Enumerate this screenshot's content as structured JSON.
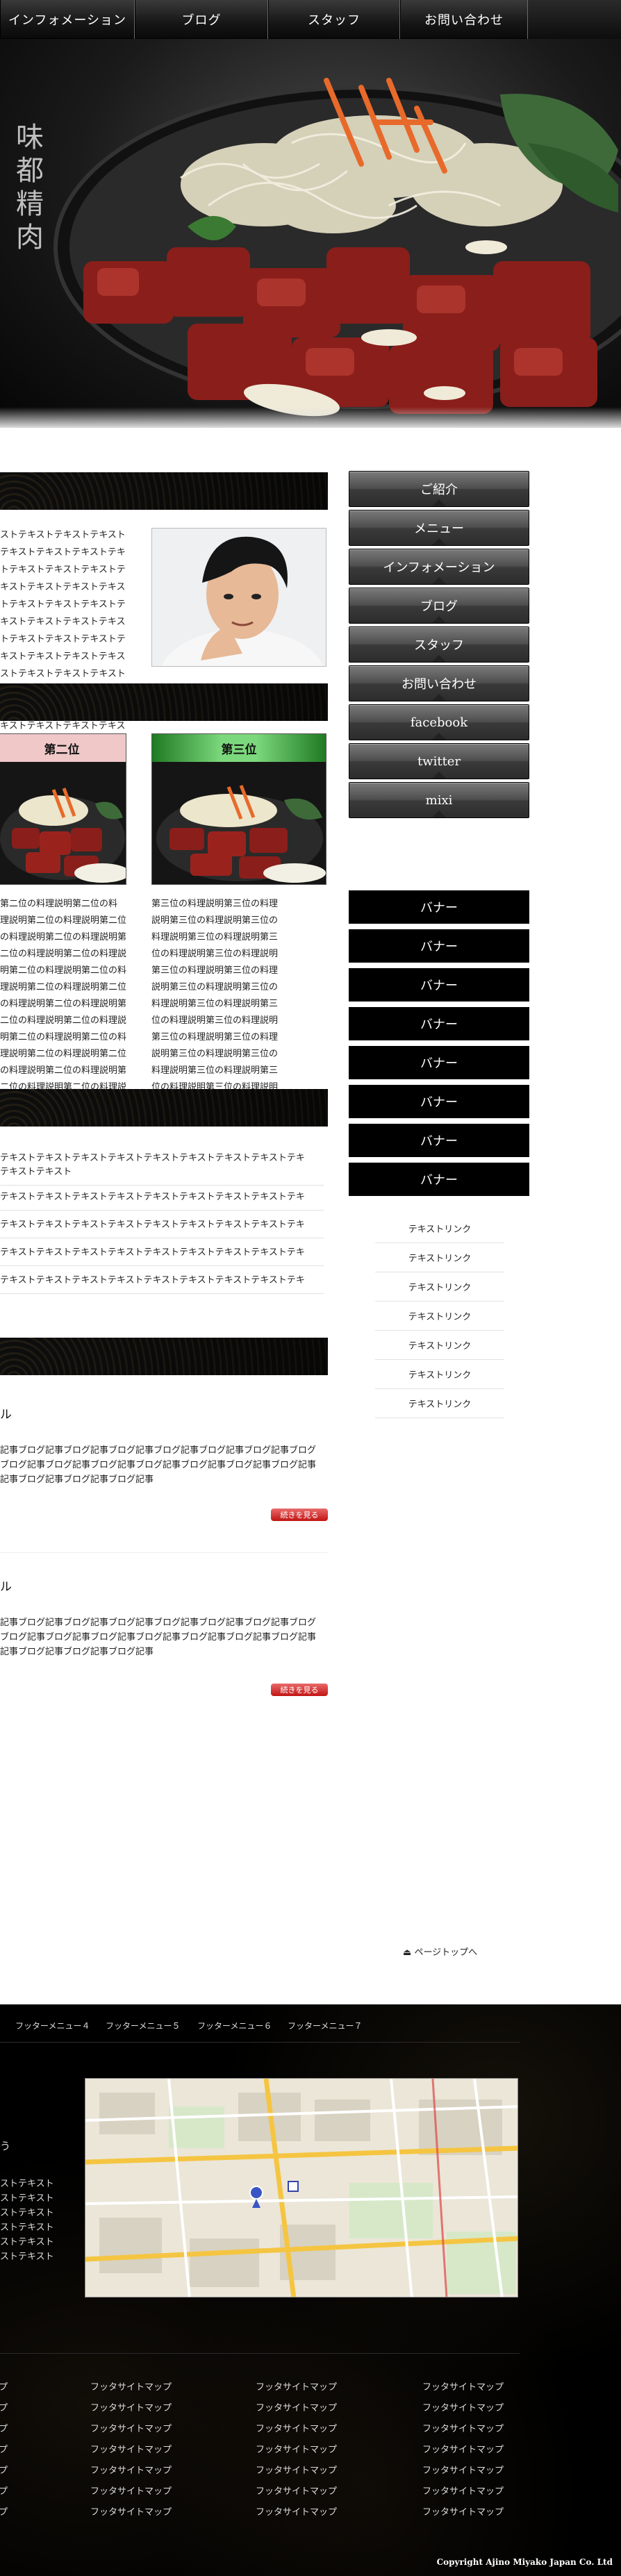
{
  "nav": {
    "items": [
      "インフォメーション",
      "ブログ",
      "スタッフ",
      "お問い合わせ"
    ]
  },
  "hero": {
    "calligraphy": "味都精肉"
  },
  "intro": {
    "text": "ストテキストテキストテキスト\nテキストテキストテキストテキ\nトテキストテキストテキストテ\nキストテキストテキストテキス\nトテキストテキストテキストテ\nキストテキストテキストテキス\nトテキストテキストテキストテ\nキストテキストテキストテキス\nストテキストテキストテキスト\nテキストテキストテキストテキ\nトテキストテキストテキストテ\nキストテキストテキストテキス"
  },
  "ranking": {
    "cards": [
      {
        "label": "第二位",
        "color": "#f0c8c8"
      },
      {
        "label": "第三位",
        "color": "#7cd87c"
      }
    ],
    "text2": "第二位の料理説明第二位の料\n理説明第二位の料理説明第二位\nの料理説明第二位の料理説明第\n二位の料理説明第二位の料理説\n明第二位の料理説明第二位の料\n理説明第二位の料理説明第二位\nの料理説明第二位の料理説明第\n二位の料理説明第二位の料理説\n明第二位の料理説明第二位の料\n理説明第二位の料理説明第二位\nの料理説明第二位の料理説明第\n二位の料理説明第二位の料理説",
    "text3": "第三位の料理説明第三位の料理\n説明第三位の料理説明第三位の\n料理説明第三位の料理説明第三\n位の料理説明第三位の料理説明\n第三位の料理説明第三位の料理\n説明第三位の料理説明第三位の\n料理説明第三位の料理説明第三\n位の料理説明第三位の料理説明\n第三位の料理説明第三位の料理\n説明第三位の料理説明第三位の\n料理説明第三位の料理説明第三\n位の料理説明第三位の料理説明"
  },
  "news": {
    "rows": [
      "テキストテキストテキストテキストテキストテキストテキストテキストテキ\nテキストテキスト",
      "テキストテキストテキストテキストテキストテキストテキストテキストテキ",
      "テキストテキストテキストテキストテキストテキストテキストテキストテキ",
      "テキストテキストテキストテキストテキストテキストテキストテキストテキ",
      "テキストテキストテキストテキストテキストテキストテキストテキストテキ"
    ]
  },
  "blog": {
    "posts": [
      {
        "title": "ル",
        "body": "記事ブログ記事ブログ記事ブログ記事ブログ記事ブログ記事ブログ記事ブログ\nブログ記事ブログ記事ブログ記事ブログ記事ブログ記事ブログ記事ブログ記事\n記事ブログ記事ブログ記事ブログ記事",
        "more": "続きを見る"
      },
      {
        "title": "ル",
        "body": "記事ブログ記事ブログ記事ブログ記事ブログ記事ブログ記事ブログ記事ブログ\nブログ記事ブログ記事ブログ記事ブログ記事ブログ記事ブログ記事ブログ記事\n記事ブログ記事ブログ記事ブログ記事",
        "more": "続きを見る"
      }
    ]
  },
  "sidebar": {
    "menu": [
      "ご紹介",
      "メニュー",
      "インフォメーション",
      "ブログ",
      "スタッフ",
      "お問い合わせ",
      "facebook",
      "twitter",
      "mixi"
    ],
    "banners": [
      "バナー",
      "バナー",
      "バナー",
      "バナー",
      "バナー",
      "バナー",
      "バナー",
      "バナー"
    ],
    "links": [
      "テキストリンク",
      "テキストリンク",
      "テキストリンク",
      "テキストリンク",
      "テキストリンク",
      "テキストリンク",
      "テキストリンク"
    ]
  },
  "pagetop": "ページトップへ",
  "footer": {
    "menu": [
      "フッターメニュー４",
      "フッターメニュー５",
      "フッターメニュー６",
      "フッターメニュー７"
    ],
    "address_title": "う",
    "address_lines": "ストテキスト\nストテキスト\nストテキスト\nストテキスト\nストテキスト\nストテキスト",
    "sitemap_label": "フッタサイトマップ",
    "sitemap_edge": "プ",
    "copyright": "Copyright Ajino Miyako Japan Co. Ltd"
  }
}
